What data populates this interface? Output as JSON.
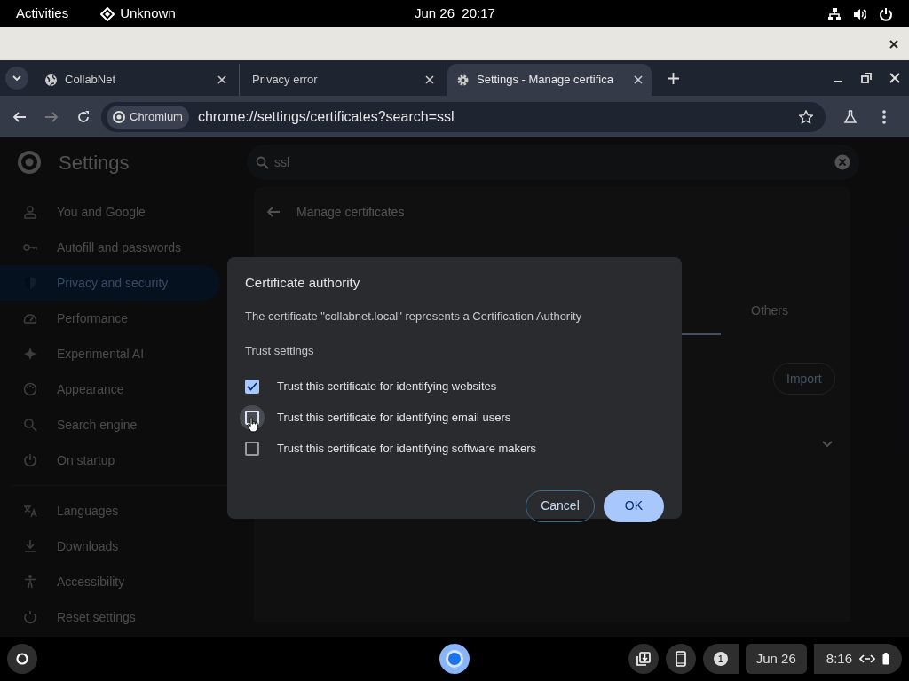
{
  "top_bar": {
    "activities": "Activities",
    "app_name": "Unknown",
    "clock": "Jun 26  20:17"
  },
  "browser": {
    "tabs": [
      {
        "title": "CollabNet",
        "selected": false
      },
      {
        "title": "Privacy error",
        "selected": false
      },
      {
        "title": "Settings - Manage certifica",
        "selected": true
      }
    ],
    "address": {
      "chip": "Chromium",
      "url": "chrome://settings/certificates?search=ssl"
    }
  },
  "settings": {
    "title": "Settings",
    "search": {
      "value": "ssl"
    },
    "nav_items": [
      {
        "label": "You and Google",
        "selected": false
      },
      {
        "label": "Autofill and passwords",
        "selected": false
      },
      {
        "label": "Privacy and security",
        "selected": true
      },
      {
        "label": "Performance",
        "selected": false
      },
      {
        "label": "Experimental AI",
        "selected": false
      },
      {
        "label": "Appearance",
        "selected": false
      },
      {
        "label": "Search engine",
        "selected": false
      },
      {
        "label": "On startup",
        "selected": false
      },
      {
        "label": "Languages",
        "selected": false
      },
      {
        "label": "Downloads",
        "selected": false
      },
      {
        "label": "Accessibility",
        "selected": false
      },
      {
        "label": "Reset settings",
        "selected": false
      }
    ],
    "page_title": "Manage certificates",
    "others_tab": {
      "label": "Others",
      "selected": false
    },
    "import_button": "Import"
  },
  "dialog": {
    "title": "Certificate authority",
    "message": "The certificate \"collabnet.local\" represents a Certification Authority",
    "section": "Trust settings",
    "options": [
      {
        "label": "Trust this certificate for identifying websites",
        "checked": true,
        "hovered": false
      },
      {
        "label": "Trust this certificate for identifying email users",
        "checked": false,
        "hovered": true
      },
      {
        "label": "Trust this certificate for identifying software makers",
        "checked": false,
        "hovered": false
      }
    ],
    "buttons": [
      {
        "label": "Cancel",
        "kind": "secondary"
      },
      {
        "label": "OK",
        "kind": "primary"
      }
    ]
  },
  "taskbar": {
    "notifications": "1",
    "date": "Jun 26",
    "time": "8:16"
  }
}
